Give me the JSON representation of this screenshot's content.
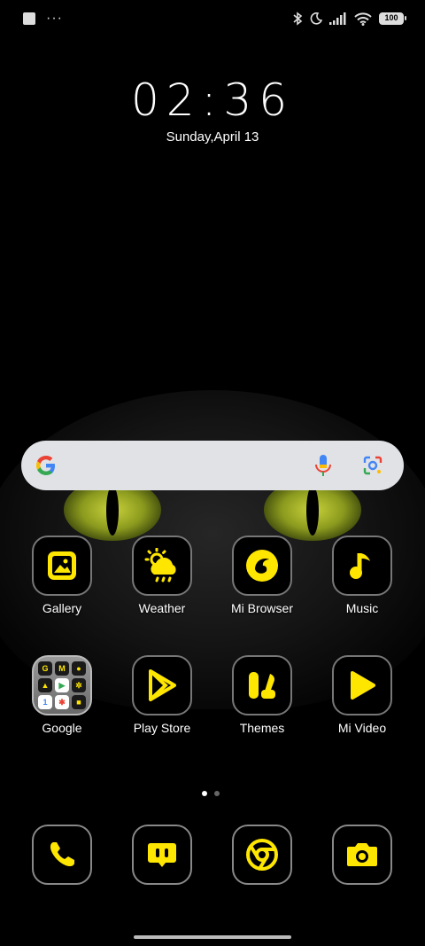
{
  "status_bar": {
    "left_icons": [
      "notification-square-icon",
      "more-dots-icon"
    ],
    "right_icons": [
      "bluetooth-icon",
      "dnd-moon-icon",
      "signal-icon",
      "wifi-icon"
    ],
    "battery": "100"
  },
  "clock": {
    "time": "02:36",
    "date": "Sunday,April 13"
  },
  "search_bar": {
    "icons": [
      "google-g-icon",
      "mic-icon",
      "lens-icon"
    ]
  },
  "apps_row1": [
    {
      "label": "Gallery",
      "icon": "gallery-icon"
    },
    {
      "label": "Weather",
      "icon": "weather-icon"
    },
    {
      "label": "Mi Browser",
      "icon": "browser-icon"
    },
    {
      "label": "Music",
      "icon": "music-icon"
    }
  ],
  "apps_row2": [
    {
      "label": "Google",
      "icon": "google-folder-icon"
    },
    {
      "label": "Play Store",
      "icon": "play-store-icon"
    },
    {
      "label": "Themes",
      "icon": "themes-icon"
    },
    {
      "label": "Mi Video",
      "icon": "video-icon"
    }
  ],
  "dock": [
    {
      "icon": "phone-icon"
    },
    {
      "icon": "messages-icon"
    },
    {
      "icon": "chrome-icon"
    },
    {
      "icon": "camera-icon"
    }
  ],
  "pager": {
    "pages": 2,
    "active": 1
  },
  "colors": {
    "accent": "#ffe600",
    "tile_border": "#777777",
    "search_bg": "#e1e2e6"
  }
}
